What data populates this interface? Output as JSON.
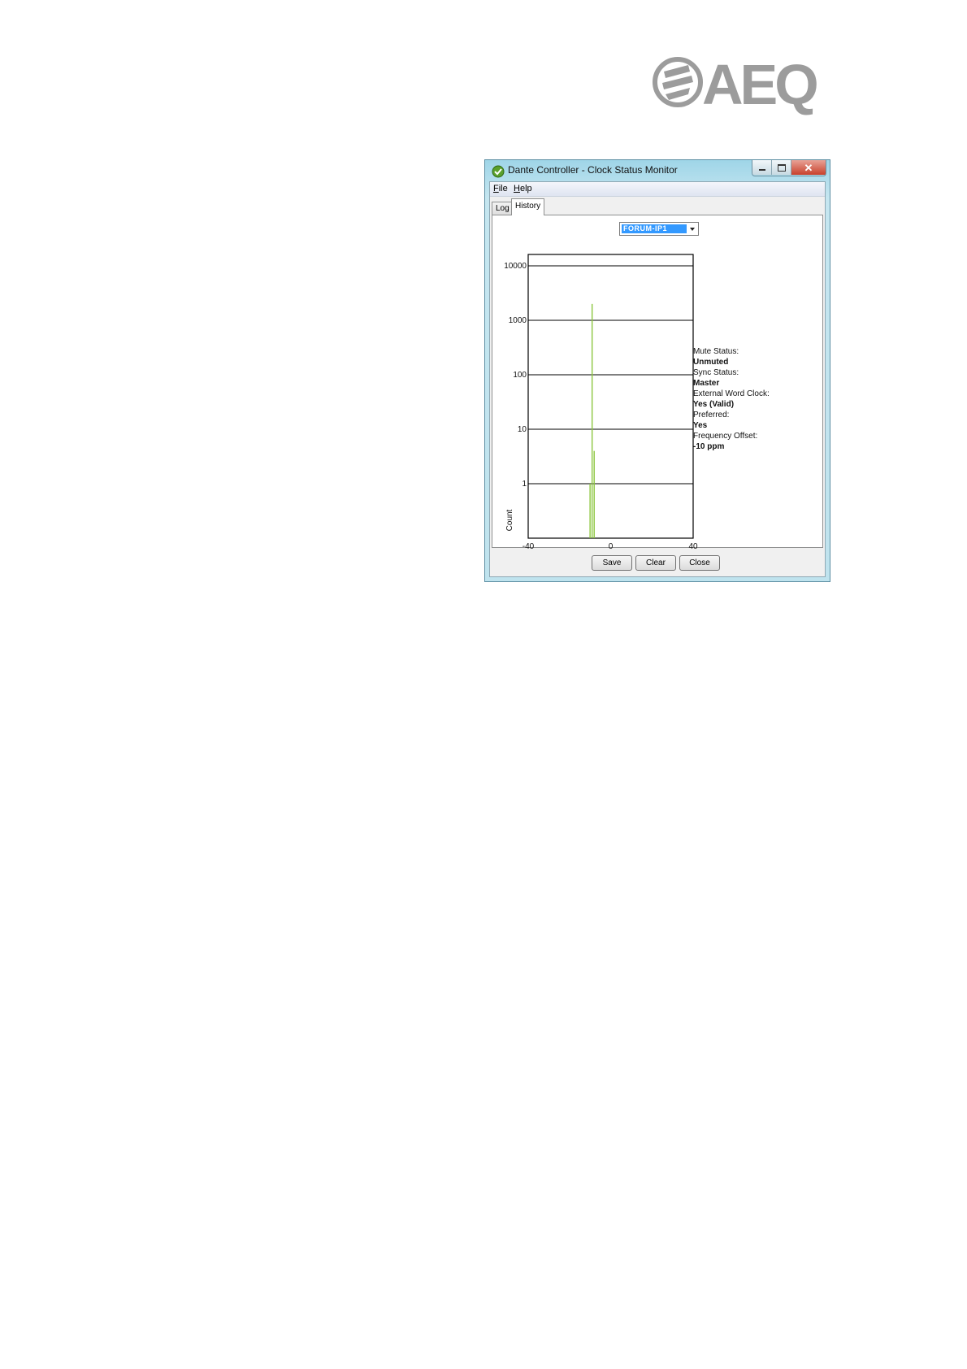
{
  "window": {
    "title": "Dante Controller - Clock Status Monitor",
    "icon": "dante-app-icon",
    "controls": [
      "minimize-icon",
      "maximize-icon",
      "close-icon"
    ]
  },
  "menu": {
    "file": {
      "mnemonic": "F",
      "rest": "ile"
    },
    "help": {
      "mnemonic": "H",
      "rest": "elp"
    }
  },
  "tabs": [
    {
      "label": "Log",
      "active": false
    },
    {
      "label": "History",
      "active": true
    }
  ],
  "device_select": {
    "selected": "FORUM-IP1"
  },
  "chart_data": {
    "type": "bar",
    "ylabel": "Count",
    "yscale": "log",
    "yticks": [
      "10000",
      "1000",
      "100",
      "10",
      "1"
    ],
    "xticks": [
      "-40",
      "0",
      "40"
    ],
    "xlim": [
      -40,
      40
    ],
    "ylim": [
      0.1,
      20000
    ],
    "grid": true,
    "series": [
      {
        "color": "#8cc63f",
        "points": [
          {
            "x": -10,
            "y": 1
          },
          {
            "x": -9,
            "y": 2000
          },
          {
            "x": -8,
            "y": 4
          }
        ]
      }
    ]
  },
  "status": [
    {
      "label": "Mute Status:",
      "value": "Unmuted"
    },
    {
      "label": "Sync Status:",
      "value": "Master"
    },
    {
      "label": "External Word Clock:",
      "value": "Yes (Valid)"
    },
    {
      "label": "Preferred:",
      "value": "Yes"
    },
    {
      "label": "Frequency Offset:",
      "value": "-10 ppm"
    }
  ],
  "buttons": {
    "save": "Save",
    "clear": "Clear",
    "close": "Close"
  },
  "logo": {
    "text": "AEQ",
    "color": "#9c9c9c"
  }
}
